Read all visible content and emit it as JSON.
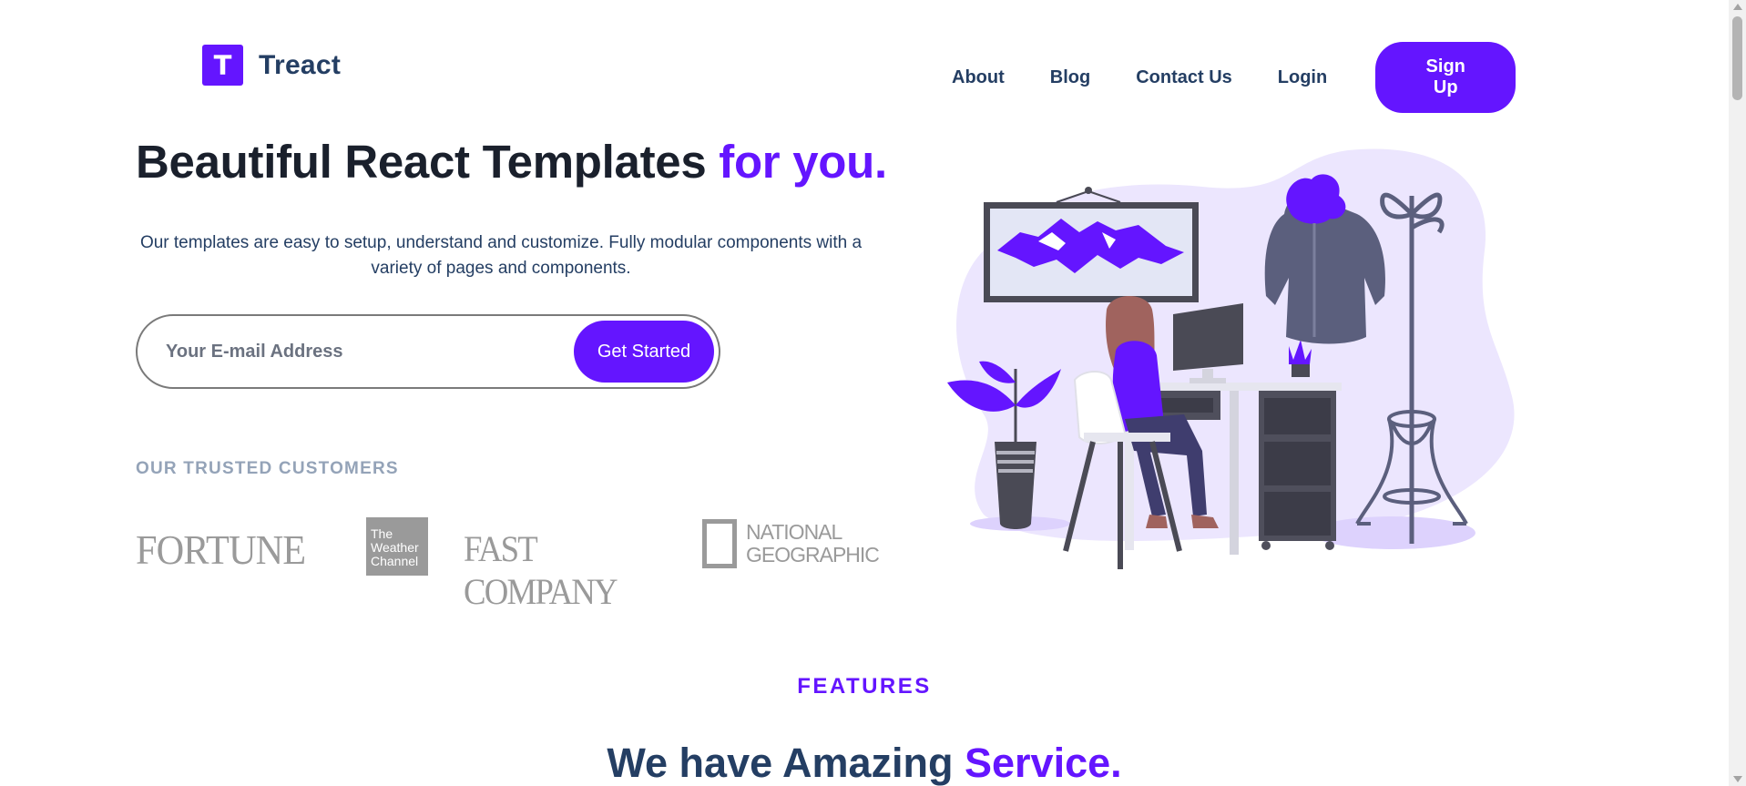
{
  "brand": {
    "logo_letter": "T",
    "name": "Treact"
  },
  "nav": {
    "items": [
      {
        "label": "About"
      },
      {
        "label": "Blog"
      },
      {
        "label": "Contact Us"
      },
      {
        "label": "Login"
      }
    ],
    "signup_label": "Sign Up"
  },
  "hero": {
    "title_main": "Beautiful React Templates",
    "title_accent": "for you.",
    "subtitle": "Our templates are easy to setup, understand and customize. Fully modular components with a variety of pages and components.",
    "email_placeholder": "Your E-mail Address",
    "cta_label": "Get Started"
  },
  "customers": {
    "label": "OUR TRUSTED CUSTOMERS",
    "logos": [
      {
        "name": "FORTUNE"
      },
      {
        "name": "The Weather Channel"
      },
      {
        "name": "FAST COMPANY"
      },
      {
        "name": "NATIONAL GEOGRAPHIC"
      }
    ]
  },
  "features": {
    "eyebrow": "FEATURES",
    "title_main": "We have Amazing",
    "title_accent": "Service."
  },
  "colors": {
    "primary": "#6415ff",
    "heading": "#1a202c",
    "text": "#243e63",
    "muted": "#94a3b8"
  }
}
